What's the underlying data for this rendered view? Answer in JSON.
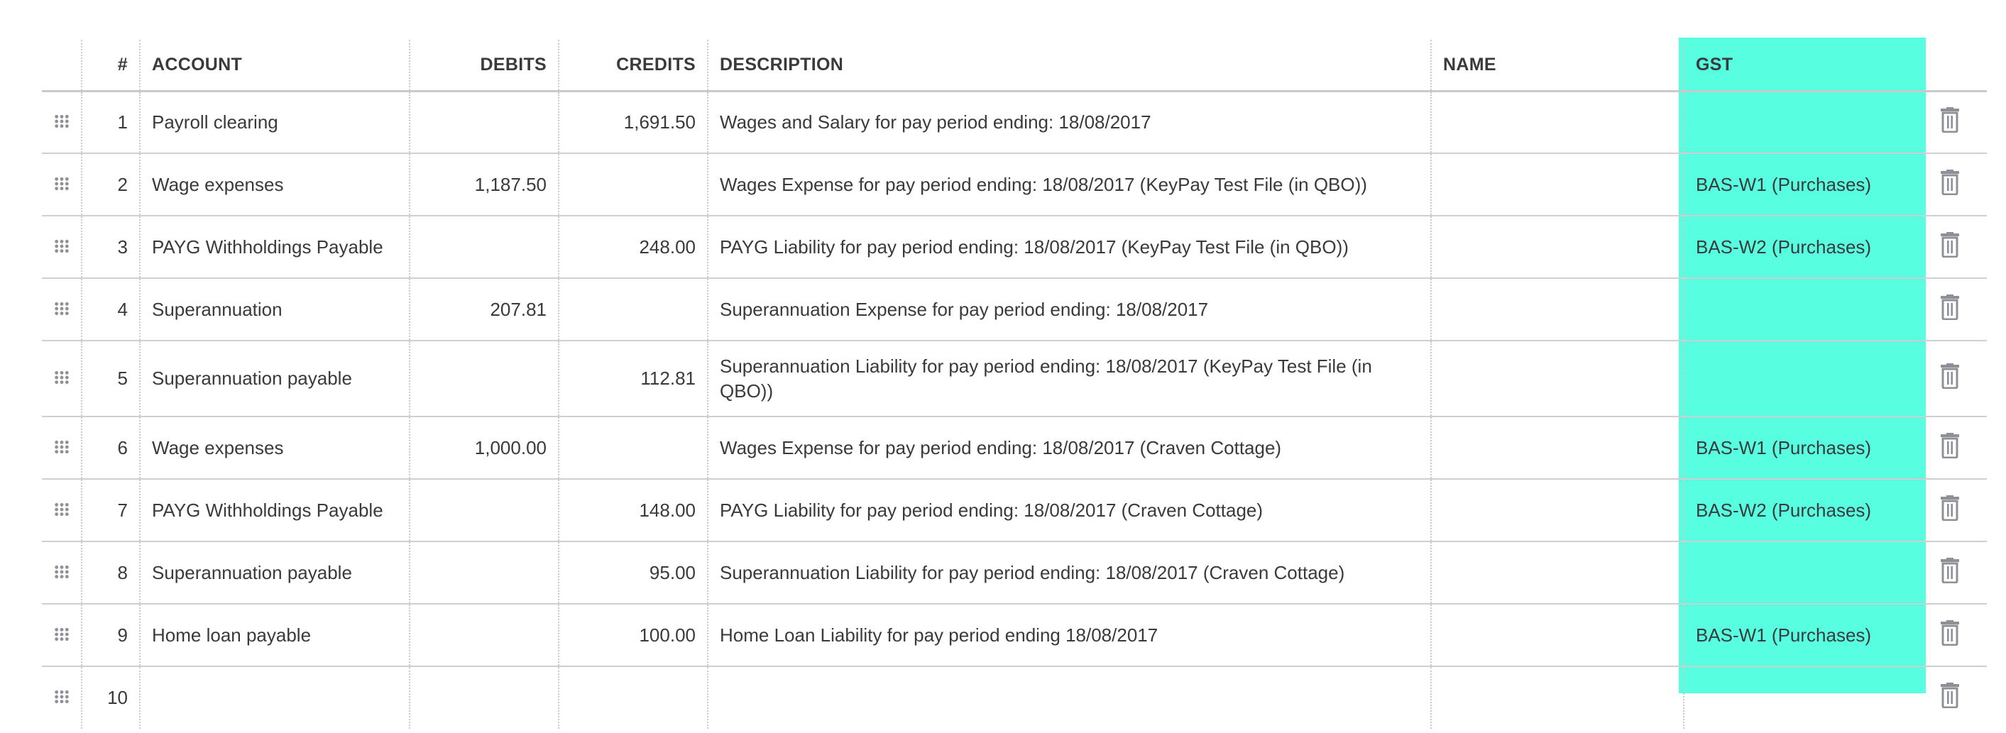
{
  "colors": {
    "gst_highlight": "#57ffe0",
    "text": "#393a3d",
    "icon": "#8d9096",
    "grid": "#c9c9c9"
  },
  "columns": {
    "num": "#",
    "account": "ACCOUNT",
    "debits": "DEBITS",
    "credits": "CREDITS",
    "description": "DESCRIPTION",
    "name": "NAME",
    "gst": "GST"
  },
  "icons": {
    "row_handle": "drag-handle-icon",
    "row_delete": "trash-icon"
  },
  "rows": [
    {
      "num": "1",
      "account": "Payroll clearing",
      "debits": "",
      "credits": "1,691.50",
      "description": "Wages and Salary for pay period ending: 18/08/2017",
      "name": "",
      "gst": ""
    },
    {
      "num": "2",
      "account": "Wage expenses",
      "debits": "1,187.50",
      "credits": "",
      "description": "Wages Expense for pay period ending: 18/08/2017 (KeyPay Test File (in QBO))",
      "name": "",
      "gst": "BAS-W1 (Purchases)"
    },
    {
      "num": "3",
      "account": "PAYG Withholdings Payable",
      "debits": "",
      "credits": "248.00",
      "description": "PAYG Liability for pay period ending: 18/08/2017 (KeyPay Test File (in QBO))",
      "name": "",
      "gst": "BAS-W2 (Purchases)"
    },
    {
      "num": "4",
      "account": "Superannuation",
      "debits": "207.81",
      "credits": "",
      "description": "Superannuation Expense for pay period ending: 18/08/2017",
      "name": "",
      "gst": ""
    },
    {
      "num": "5",
      "account": "Superannuation payable",
      "debits": "",
      "credits": "112.81",
      "description": "Superannuation Liability for pay period ending: 18/08/2017 (KeyPay Test File (in QBO))",
      "name": "",
      "gst": ""
    },
    {
      "num": "6",
      "account": "Wage expenses",
      "debits": "1,000.00",
      "credits": "",
      "description": "Wages Expense for pay period ending: 18/08/2017 (Craven Cottage)",
      "name": "",
      "gst": "BAS-W1 (Purchases)"
    },
    {
      "num": "7",
      "account": "PAYG Withholdings Payable",
      "debits": "",
      "credits": "148.00",
      "description": "PAYG Liability for pay period ending: 18/08/2017 (Craven Cottage)",
      "name": "",
      "gst": "BAS-W2 (Purchases)"
    },
    {
      "num": "8",
      "account": "Superannuation payable",
      "debits": "",
      "credits": "95.00",
      "description": "Superannuation Liability for pay period ending: 18/08/2017 (Craven Cottage)",
      "name": "",
      "gst": ""
    },
    {
      "num": "9",
      "account": "Home loan payable",
      "debits": "",
      "credits": "100.00",
      "description": "Home Loan Liability for pay period ending 18/08/2017",
      "name": "",
      "gst": "BAS-W1 (Purchases)"
    },
    {
      "num": "10",
      "account": "",
      "debits": "",
      "credits": "",
      "description": "",
      "name": "",
      "gst": ""
    }
  ]
}
